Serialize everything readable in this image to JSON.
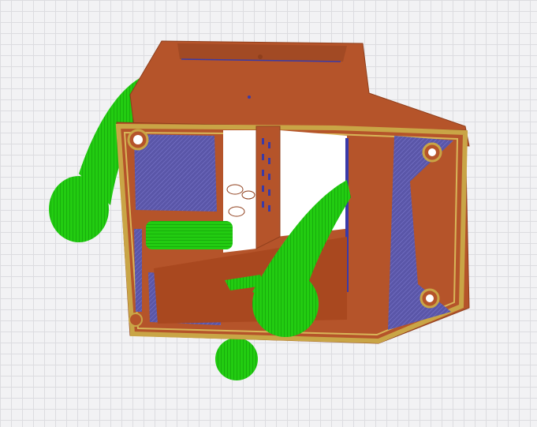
{
  "viewer": {
    "bed_color": "#f2f2f4",
    "grid_color": "#dcdce0"
  },
  "model": {
    "body_color": "#b5542a",
    "perimeter_color": "#c9a546",
    "infill_color": "#5a56a8",
    "support_color": "#22cc11",
    "hole_color": "#ffffff"
  }
}
